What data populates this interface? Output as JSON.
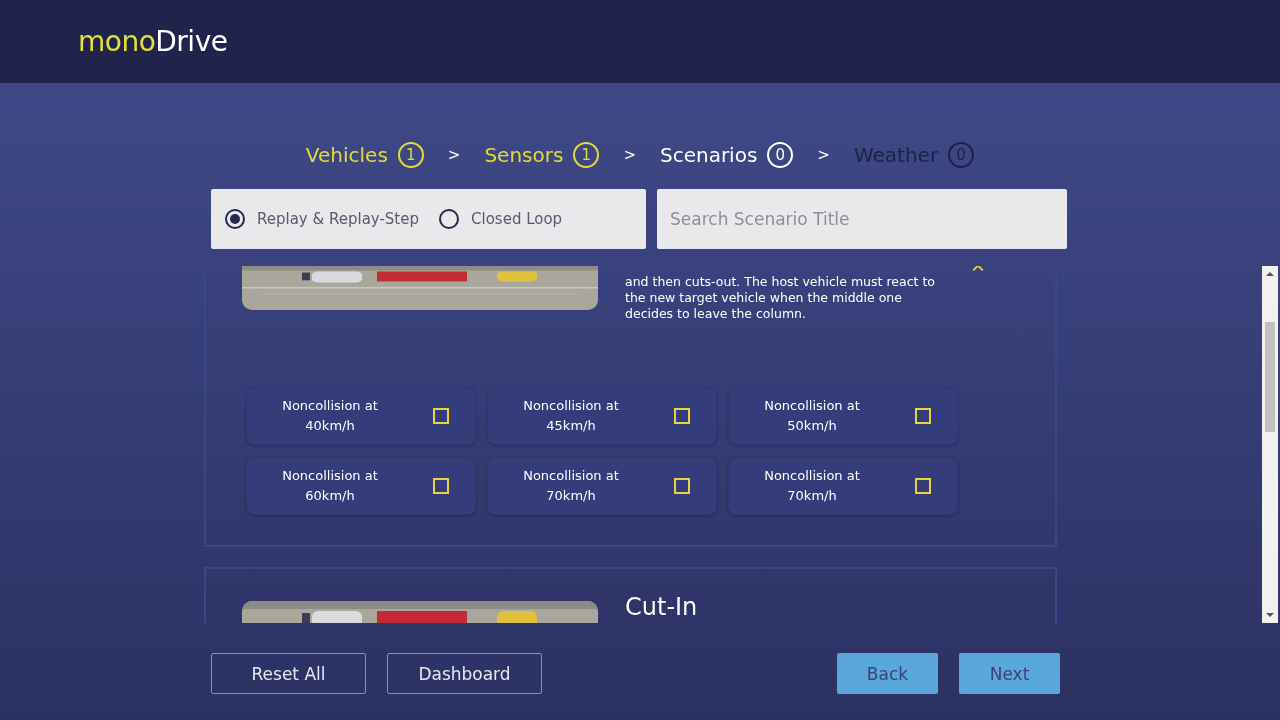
{
  "header": {
    "logo_part1": "mono",
    "logo_part2": "Drive"
  },
  "steps": [
    {
      "label": "Vehicles",
      "count": "1",
      "done": true,
      "selected": false
    },
    {
      "label": "Sensors",
      "count": "1",
      "done": true,
      "selected": false
    },
    {
      "label": "Scenarios",
      "count": "0",
      "done": false,
      "selected": true
    },
    {
      "label": "Weather",
      "count": "0",
      "done": false,
      "selected": false
    }
  ],
  "step_separator": ">",
  "filter": {
    "modes": [
      {
        "label": "Replay & Replay-Step",
        "selected": true
      },
      {
        "label": "Closed Loop",
        "selected": false
      }
    ],
    "search": {
      "placeholder": "Search Scenario Title"
    }
  },
  "scenarios": [
    {
      "description": "and then cuts-out. The host vehicle must react to the new target vehicle when the middle one decides to leave the column.",
      "expanded": true,
      "options": [
        {
          "label": "Noncollision at 40km/h",
          "checked": false
        },
        {
          "label": "Noncollision at 45km/h",
          "checked": false
        },
        {
          "label": "Noncollision at 50km/h",
          "checked": false
        },
        {
          "label": "Noncollision at 60km/h",
          "checked": false
        },
        {
          "label": "Noncollision at 70km/h",
          "checked": false
        },
        {
          "label": "Noncollision at 70km/h",
          "checked": false
        }
      ]
    },
    {
      "title": "Cut-In",
      "expanded": false
    }
  ],
  "footer": {
    "left_buttons": [
      "Reset All",
      "Dashboard"
    ],
    "right_buttons": [
      "Back",
      "Next"
    ]
  }
}
